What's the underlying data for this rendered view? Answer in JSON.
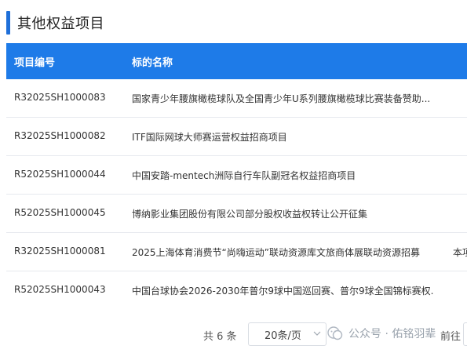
{
  "section": {
    "title": "其他权益项目"
  },
  "table": {
    "headers": {
      "code": "项目编号",
      "name": "标的名称"
    },
    "rows": [
      {
        "code": "R32025SH1000083",
        "name": "国家青少年腰旗橄榄球队及全国青少年U系列腰旗橄榄球比赛装备赞助...",
        "extra": ""
      },
      {
        "code": "R32025SH1000082",
        "name": "ITF国际网球大师赛运营权益招商项目",
        "extra": ""
      },
      {
        "code": "R52025SH1000044",
        "name": "中国安踏-mentech洲际自行车队副冠名权益招商项目",
        "extra": ""
      },
      {
        "code": "R52025SH1000045",
        "name": "博纳影业集团股份有限公司部分股权收益权转让公开征集",
        "extra": ""
      },
      {
        "code": "R32025SH1000081",
        "name": "2025上海体育消费节“尚嗨运动”联动资源库文旅商体展联动资源招募",
        "extra": "本项"
      },
      {
        "code": "R52025SH1000043",
        "name": "中国台球协会2026-2030年普尔9球中国巡回赛、普尔9球全国锦标赛权...",
        "extra": ""
      }
    ]
  },
  "pagination": {
    "total_text": "共 6 条",
    "page_size": "20条/页",
    "goto_label": "前往"
  },
  "watermark": {
    "text": "公众号 · 佑铭羽辈"
  },
  "colors": {
    "accent": "#1e7be8",
    "section_bar": "#1e6fd9"
  }
}
